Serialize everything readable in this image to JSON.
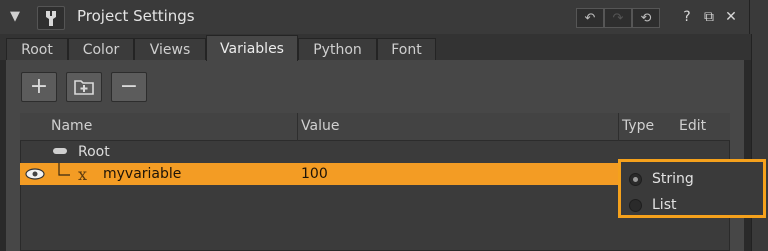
{
  "window": {
    "title": "Project Settings",
    "collapse_glyph": "▼",
    "help_glyph": "?",
    "float_glyph": "⧉",
    "close_glyph": "✕",
    "undo_glyph": "↶",
    "redo_glyph": "↷",
    "revert_glyph": "⟲"
  },
  "tabs": [
    {
      "label": "Root",
      "active": false
    },
    {
      "label": "Color",
      "active": false
    },
    {
      "label": "Views",
      "active": false
    },
    {
      "label": "Variables",
      "active": true
    },
    {
      "label": "Python",
      "active": false
    },
    {
      "label": "Font",
      "active": false
    }
  ],
  "toolbar": {
    "add_glyph": "+",
    "remove_glyph": "−"
  },
  "table": {
    "columns": [
      "Name",
      "Value",
      "Type",
      "Edit"
    ],
    "rows": [
      {
        "name": "Root",
        "value": "",
        "selected": false
      },
      {
        "name": "myvariable",
        "value": "100",
        "selected": true
      }
    ]
  },
  "type_popup": {
    "options": [
      {
        "label": "String",
        "checked": true
      },
      {
        "label": "List",
        "checked": false
      }
    ]
  },
  "colors": {
    "accent": "#f39c24",
    "popup_border": "#f5a11c",
    "background": "#474747"
  }
}
